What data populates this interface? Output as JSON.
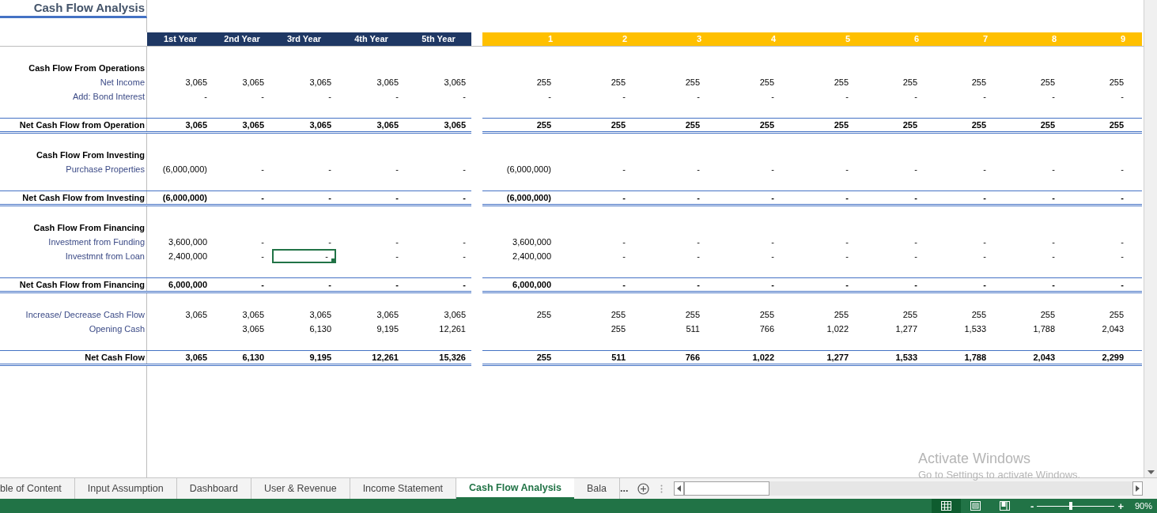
{
  "title": "Cash Flow Analysis",
  "year_headers": [
    "1st Year",
    "2nd Year",
    "3rd Year",
    "4th Year",
    "5th Year"
  ],
  "month_headers": [
    "1",
    "2",
    "3",
    "4",
    "5",
    "6",
    "7",
    "8",
    "9"
  ],
  "sections": [
    {
      "title": "Cash Flow From Operations",
      "items": [
        {
          "label": "Net Income",
          "years": [
            {
              "value": "3,065",
              "selected": false
            },
            {
              "value": "3,065",
              "selected": false
            },
            {
              "value": "3,065",
              "selected": false
            },
            {
              "value": "3,065",
              "selected": false
            },
            {
              "value": "3,065",
              "selected": false
            }
          ],
          "months": [
            "255",
            "255",
            "255",
            "255",
            "255",
            "255",
            "255",
            "255",
            "255"
          ]
        },
        {
          "label": "Add: Bond Interest",
          "years": [
            {
              "value": "-",
              "selected": false
            },
            {
              "value": "-",
              "selected": false
            },
            {
              "value": "-",
              "selected": false
            },
            {
              "value": "-",
              "selected": false
            },
            {
              "value": "-",
              "selected": false
            }
          ],
          "months": [
            "-",
            "-",
            "-",
            "-",
            "-",
            "-",
            "-",
            "-",
            "-"
          ]
        }
      ],
      "total": {
        "label": "Net Cash Flow from Operation",
        "years": [
          {
            "value": "3,065",
            "selected": false
          },
          {
            "value": "3,065",
            "selected": false
          },
          {
            "value": "3,065",
            "selected": false
          },
          {
            "value": "3,065",
            "selected": false
          },
          {
            "value": "3,065",
            "selected": false
          }
        ],
        "months": [
          "255",
          "255",
          "255",
          "255",
          "255",
          "255",
          "255",
          "255",
          "255"
        ]
      }
    },
    {
      "title": "Cash Flow From Investing",
      "items": [
        {
          "label": "Purchase Properties",
          "years": [
            {
              "value": "(6,000,000)",
              "selected": false
            },
            {
              "value": "-",
              "selected": false
            },
            {
              "value": "-",
              "selected": false
            },
            {
              "value": "-",
              "selected": false
            },
            {
              "value": "-",
              "selected": false
            }
          ],
          "months": [
            "(6,000,000)",
            "-",
            "-",
            "-",
            "-",
            "-",
            "-",
            "-",
            "-"
          ]
        }
      ],
      "total": {
        "label": "Net Cash Flow from Investing",
        "years": [
          {
            "value": "(6,000,000)",
            "selected": false
          },
          {
            "value": "-",
            "selected": false
          },
          {
            "value": "-",
            "selected": false
          },
          {
            "value": "-",
            "selected": false
          },
          {
            "value": "-",
            "selected": false
          }
        ],
        "months": [
          "(6,000,000)",
          "-",
          "-",
          "-",
          "-",
          "-",
          "-",
          "-",
          "-"
        ]
      }
    },
    {
      "title": "Cash Flow From Financing",
      "items": [
        {
          "label": "Investment from Funding",
          "years": [
            {
              "value": "3,600,000",
              "selected": false
            },
            {
              "value": "-",
              "selected": false
            },
            {
              "value": "-",
              "selected": false
            },
            {
              "value": "-",
              "selected": false
            },
            {
              "value": "-",
              "selected": false
            }
          ],
          "months": [
            "3,600,000",
            "-",
            "-",
            "-",
            "-",
            "-",
            "-",
            "-",
            "-"
          ]
        },
        {
          "label": "Investmnt from Loan",
          "years": [
            {
              "value": "2,400,000",
              "selected": false
            },
            {
              "value": "-",
              "selected": false
            },
            {
              "value": "-",
              "selected": true
            },
            {
              "value": "-",
              "selected": false
            },
            {
              "value": "-",
              "selected": false
            }
          ],
          "months": [
            "2,400,000",
            "-",
            "-",
            "-",
            "-",
            "-",
            "-",
            "-",
            "-"
          ]
        }
      ],
      "total": {
        "label": "Net Cash Flow from Financing",
        "years": [
          {
            "value": "6,000,000",
            "selected": false
          },
          {
            "value": "-",
            "selected": false
          },
          {
            "value": "-",
            "selected": false
          },
          {
            "value": "-",
            "selected": false
          },
          {
            "value": "-",
            "selected": false
          }
        ],
        "months": [
          "6,000,000",
          "-",
          "-",
          "-",
          "-",
          "-",
          "-",
          "-",
          "-"
        ]
      }
    },
    {
      "items": [
        {
          "label": "Increase/ Decrease Cash Flow",
          "years": [
            {
              "value": "3,065",
              "selected": false
            },
            {
              "value": "3,065",
              "selected": false
            },
            {
              "value": "3,065",
              "selected": false
            },
            {
              "value": "3,065",
              "selected": false
            },
            {
              "value": "3,065",
              "selected": false
            }
          ],
          "months": [
            "255",
            "255",
            "255",
            "255",
            "255",
            "255",
            "255",
            "255",
            "255"
          ]
        },
        {
          "label": "Opening Cash",
          "years": [
            {
              "selected": false
            },
            {
              "value": "3,065",
              "selected": false
            },
            {
              "value": "6,130",
              "selected": false
            },
            {
              "value": "9,195",
              "selected": false
            },
            {
              "value": "12,261",
              "selected": false
            }
          ],
          "first_month_blank": true,
          "months": [
            "255",
            "511",
            "766",
            "1,022",
            "1,277",
            "1,533",
            "1,788",
            "2,043"
          ]
        }
      ],
      "total": {
        "label": "Net Cash Flow",
        "years": [
          {
            "value": "3,065",
            "selected": false
          },
          {
            "value": "6,130",
            "selected": false
          },
          {
            "value": "9,195",
            "selected": false
          },
          {
            "value": "12,261",
            "selected": false
          },
          {
            "value": "15,326",
            "selected": false
          }
        ],
        "months": [
          "255",
          "511",
          "766",
          "1,022",
          "1,277",
          "1,533",
          "1,788",
          "2,043",
          "2,299"
        ]
      }
    }
  ],
  "sheet_tabs": [
    {
      "label": "ble of Content",
      "selected": false
    },
    {
      "label": "Input Assumption",
      "selected": false
    },
    {
      "label": "Dashboard",
      "selected": false
    },
    {
      "label": "User & Revenue",
      "selected": false
    },
    {
      "label": "Income Statement",
      "selected": false
    },
    {
      "label": "Cash Flow Analysis",
      "selected": true
    },
    {
      "label": "Bala",
      "selected": false
    }
  ],
  "more_tabs": "...",
  "os_notice": {
    "title": "Activate Windows",
    "text": "Go to Settings to activate Windows."
  },
  "views": [
    {
      "kind": "normal",
      "selected": true
    },
    {
      "kind": "page_layout",
      "selected": false
    },
    {
      "kind": "page_break",
      "selected": false
    }
  ],
  "zoom": {
    "minus": "-",
    "plus": "+",
    "level": 0.44,
    "reading": "90%"
  }
}
